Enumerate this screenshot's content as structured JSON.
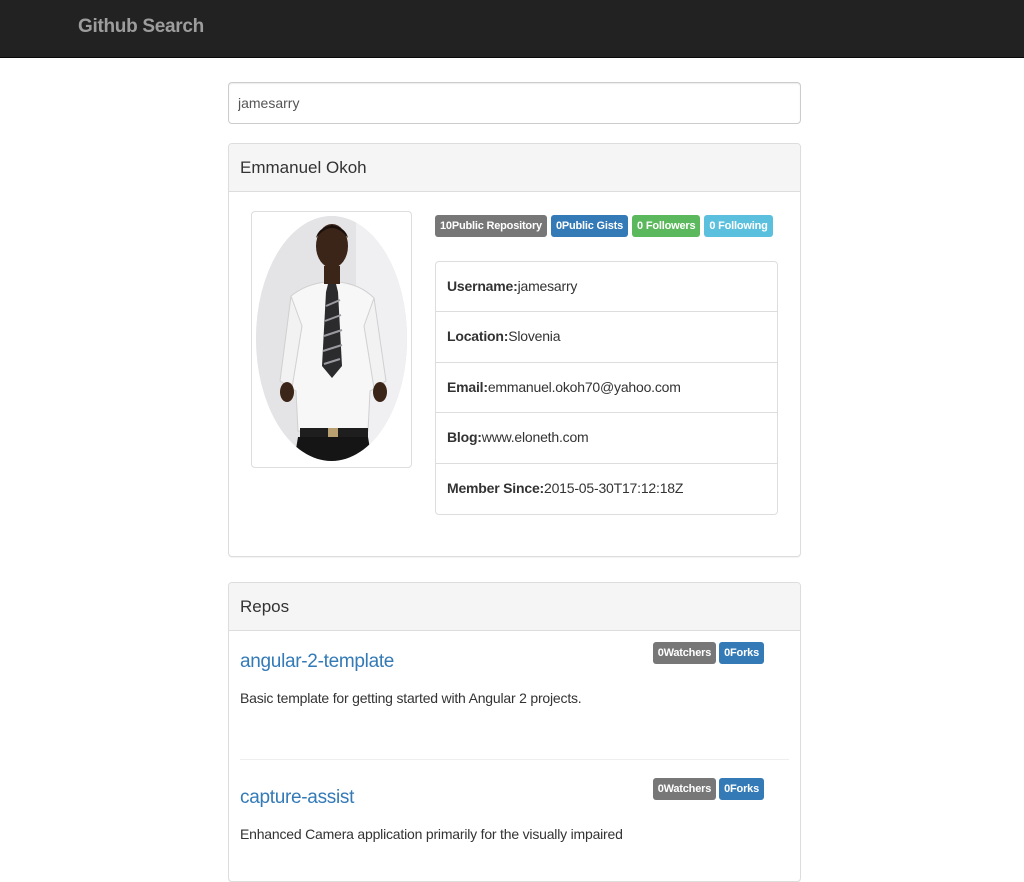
{
  "navbar": {
    "brand": "Github Search"
  },
  "search": {
    "value": "jamesarry"
  },
  "profile": {
    "name": "Emmanuel Okoh",
    "badges": [
      {
        "label": "10Public Repository",
        "style": "default"
      },
      {
        "label": "0Public Gists",
        "style": "primary"
      },
      {
        "label": "0 Followers",
        "style": "success"
      },
      {
        "label": "0 Following",
        "style": "info"
      }
    ],
    "details": [
      {
        "label": "Username:",
        "value": "jamesarry"
      },
      {
        "label": "Location:",
        "value": "Slovenia"
      },
      {
        "label": "Email:",
        "value": "emmanuel.okoh70@yahoo.com"
      },
      {
        "label": "Blog:",
        "value": "www.eloneth.com"
      },
      {
        "label": "Member Since:",
        "value": "2015-05-30T17:12:18Z"
      }
    ]
  },
  "repos": {
    "heading": "Repos",
    "items": [
      {
        "name": "angular-2-template",
        "description": "Basic template for getting started with Angular 2 projects.",
        "watchers": "0Watchers",
        "forks": "0Forks"
      },
      {
        "name": "capture-assist",
        "description": "Enhanced Camera application primarily for the visually impaired",
        "watchers": "0Watchers",
        "forks": "0Forks"
      }
    ]
  },
  "colors": {
    "navbar": "#222222",
    "brand": "#9d9d9d",
    "link": "#337ab7",
    "badge_default": "#777777",
    "badge_primary": "#337ab7",
    "badge_success": "#5cb85c",
    "badge_info": "#5bc0de"
  }
}
